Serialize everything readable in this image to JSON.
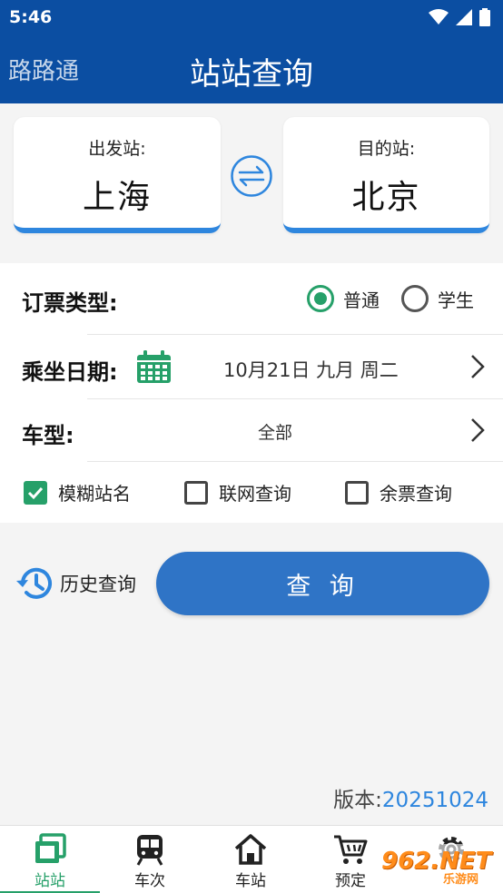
{
  "status_bar": {
    "time": "5:46"
  },
  "header": {
    "app_name": "路路通",
    "title": "站站查询"
  },
  "stations": {
    "from_label": "出发站:",
    "from_name": "上海",
    "to_label": "目的站:",
    "to_name": "北京"
  },
  "ticket_type": {
    "label": "订票类型:",
    "options": [
      "普通",
      "学生"
    ],
    "selected": "普通"
  },
  "travel_date": {
    "label": "乘坐日期:",
    "value": "10月21日 九月 周二"
  },
  "train_type": {
    "label": "车型:",
    "value": "全部"
  },
  "checkboxes": [
    {
      "label": "模糊站名",
      "checked": true
    },
    {
      "label": "联网查询",
      "checked": false
    },
    {
      "label": "余票查询",
      "checked": false
    }
  ],
  "history": {
    "label": "历史查询"
  },
  "query_button": {
    "label": "查 询"
  },
  "version": {
    "label": "版本:",
    "number": "20251024"
  },
  "bottom_nav": {
    "items": [
      {
        "label": "站站",
        "icon": "station-pair-icon",
        "active": true
      },
      {
        "label": "车次",
        "icon": "train-icon",
        "active": false
      },
      {
        "label": "车站",
        "icon": "house-icon",
        "active": false
      },
      {
        "label": "预定",
        "icon": "cart-icon",
        "active": false
      },
      {
        "label": "",
        "icon": "gear-icon",
        "active": false
      }
    ]
  },
  "watermark": {
    "text": "962.NET",
    "sub": "乐游网"
  },
  "colors": {
    "primary": "#0b4ea2",
    "accent": "#2e86de",
    "green": "#26a069",
    "button": "#2f74c6"
  }
}
